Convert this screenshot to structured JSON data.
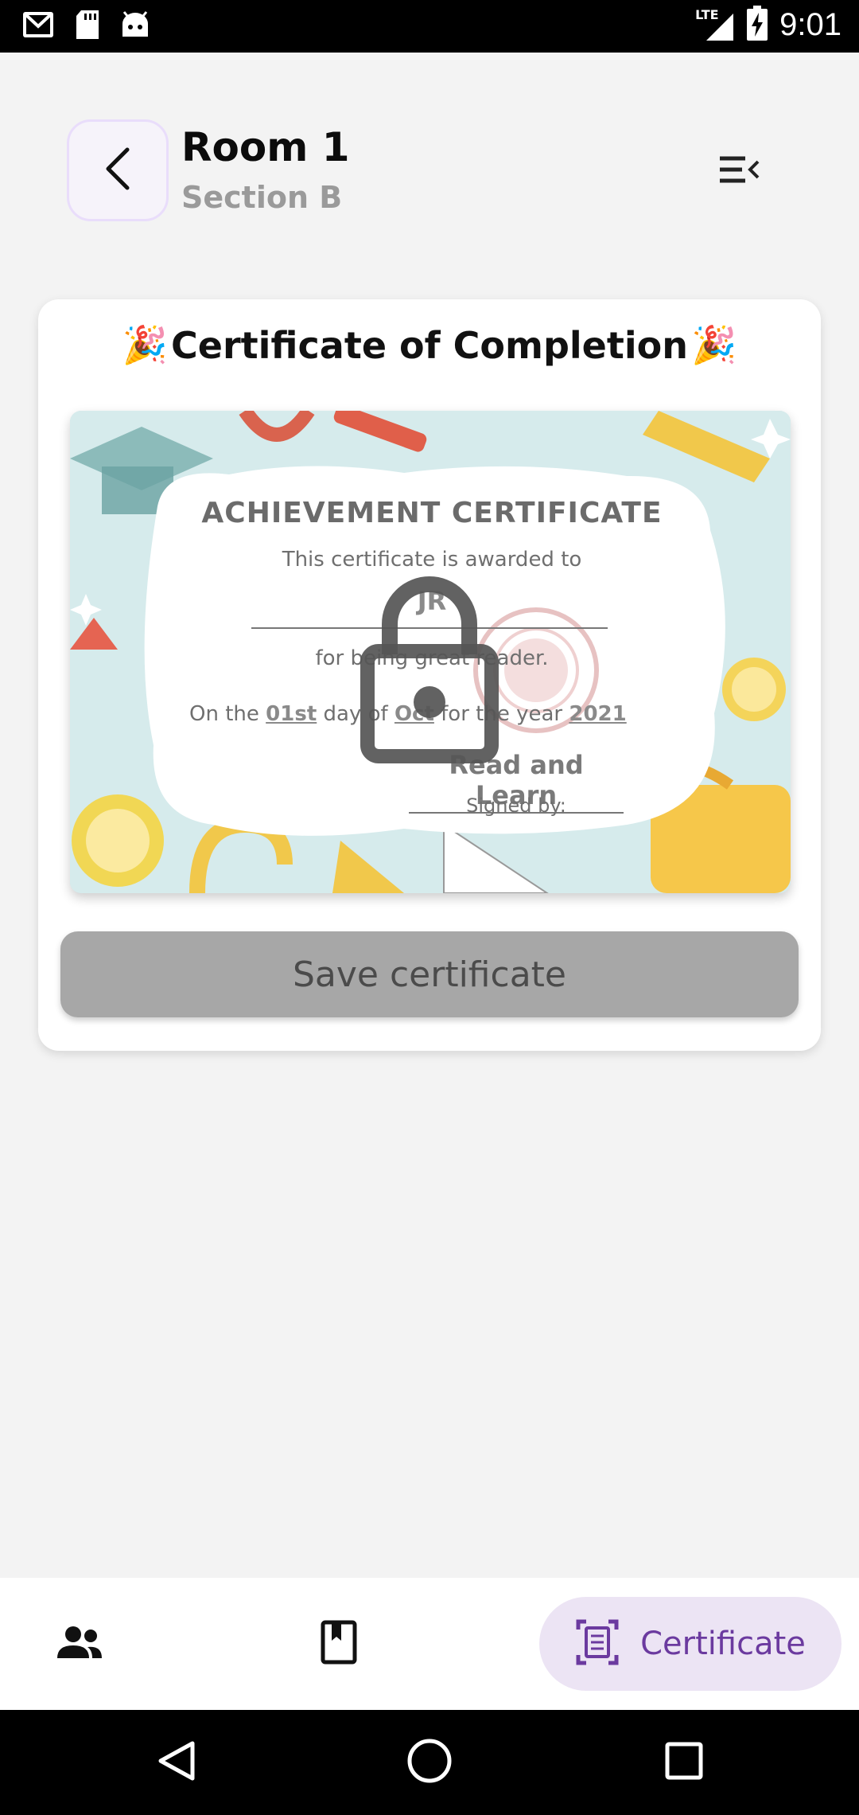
{
  "status_bar": {
    "time": "9:01",
    "network": "LTE",
    "icons": [
      "gmail-icon",
      "sd-card-icon",
      "android-icon",
      "signal-icon",
      "battery-charging-icon"
    ]
  },
  "header": {
    "title": "Room 1",
    "subtitle": "Section B"
  },
  "card": {
    "title": "Certificate of Completion",
    "title_emoji": "🎉",
    "certificate": {
      "heading": "ACHIEVEMENT CERTIFICATE",
      "awarded_text": "This certificate is awarded to",
      "recipient": "JR",
      "reason": "for being great reader.",
      "on_the": "On the",
      "day": "01st",
      "day_of": "day of",
      "month": "Oct",
      "for_the_year": "for the year",
      "year": "2021",
      "signature": "Read and Learn",
      "signed_by": "Signed by:",
      "locked": true
    },
    "save_label": "Save certificate"
  },
  "bottom_nav": {
    "items": [
      {
        "icon": "people-icon",
        "label": ""
      },
      {
        "icon": "book-icon",
        "label": ""
      },
      {
        "icon": "certificate-icon",
        "label": "Certificate",
        "active": true
      }
    ]
  },
  "colors": {
    "accent": "#6b3a9f",
    "accent_bg": "#ece4f4",
    "disabled_button": "#a7a7a7"
  }
}
